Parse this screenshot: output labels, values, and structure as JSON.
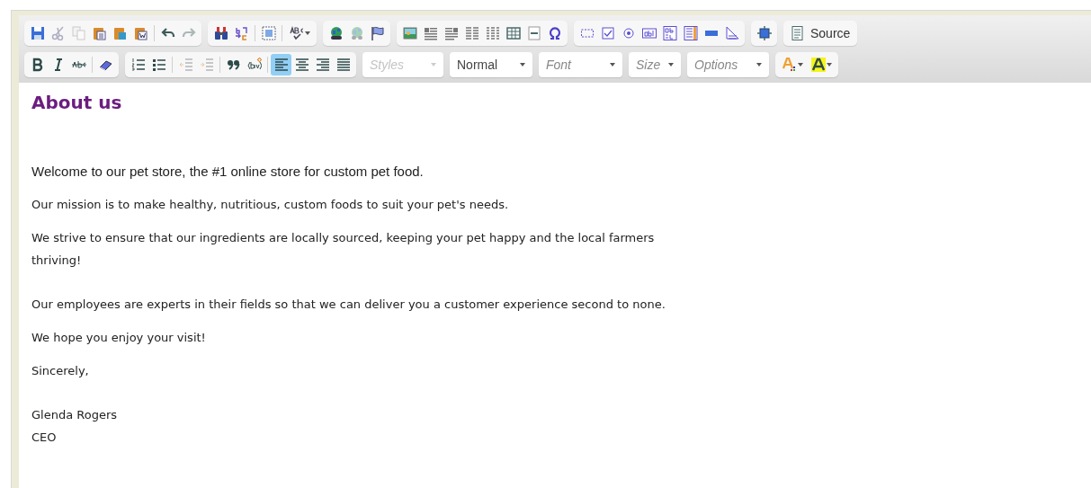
{
  "toolbar": {
    "rows": [
      [
        {
          "buttons": [
            {
              "kind": "icon",
              "disabled": false
            },
            {
              "kind": "icon",
              "disabled": true
            },
            {
              "kind": "icon",
              "disabled": true
            },
            {
              "kind": "icon",
              "disabled": false
            },
            {
              "kind": "icon",
              "disabled": false
            },
            {
              "kind": "icon",
              "disabled": false
            },
            {
              "kind": "sep"
            },
            {
              "kind": "icon",
              "disabled": false
            },
            {
              "kind": "icon",
              "disabled": true
            }
          ]
        },
        {
          "buttons": [
            {
              "kind": "icon",
              "disabled": false
            },
            {
              "kind": "icon",
              "disabled": false
            },
            {
              "kind": "sep"
            },
            {
              "kind": "icon",
              "disabled": false
            },
            {
              "kind": "sep"
            },
            {
              "kind": "menu",
              "disabled": false
            }
          ]
        },
        {
          "buttons": [
            {
              "kind": "icon",
              "disabled": false
            },
            {
              "kind": "icon",
              "disabled": true
            },
            {
              "kind": "icon",
              "disabled": false
            }
          ]
        },
        {
          "buttons": [
            {
              "kind": "icon",
              "disabled": false
            },
            {
              "kind": "icon",
              "disabled": false
            },
            {
              "kind": "icon",
              "disabled": false
            },
            {
              "kind": "icon",
              "disabled": false
            },
            {
              "kind": "icon",
              "disabled": false
            },
            {
              "kind": "icon",
              "disabled": false
            },
            {
              "kind": "icon",
              "disabled": false
            },
            {
              "kind": "icon",
              "disabled": false
            }
          ]
        },
        {
          "buttons": [
            {
              "kind": "icon",
              "disabled": false
            },
            {
              "kind": "icon",
              "disabled": false
            },
            {
              "kind": "icon",
              "disabled": false
            },
            {
              "kind": "icon",
              "disabled": false
            },
            {
              "kind": "icon",
              "disabled": false
            },
            {
              "kind": "icon",
              "disabled": false
            },
            {
              "kind": "icon",
              "disabled": false
            },
            {
              "kind": "icon",
              "disabled": false
            }
          ]
        },
        {
          "buttons": [
            {
              "kind": "icon",
              "disabled": false
            }
          ]
        },
        {
          "buttons": [
            {
              "kind": "text",
              "label": "Source"
            }
          ]
        }
      ],
      [
        {
          "buttons": [
            {
              "kind": "icon",
              "disabled": false,
              "selected": false
            },
            {
              "kind": "icon",
              "disabled": false,
              "selected": false
            },
            {
              "kind": "icon",
              "disabled": false,
              "selected": false
            },
            {
              "kind": "sep"
            },
            {
              "kind": "icon",
              "disabled": false,
              "selected": false
            }
          ]
        },
        {
          "buttons": [
            {
              "kind": "icon",
              "disabled": false,
              "selected": false
            },
            {
              "kind": "icon",
              "disabled": false,
              "selected": false
            },
            {
              "kind": "sep"
            },
            {
              "kind": "icon",
              "disabled": true,
              "selected": false
            },
            {
              "kind": "icon",
              "disabled": true,
              "selected": false
            },
            {
              "kind": "sep"
            },
            {
              "kind": "icon",
              "disabled": false,
              "selected": false
            },
            {
              "kind": "icon",
              "disabled": false,
              "selected": false
            },
            {
              "kind": "sep"
            },
            {
              "kind": "icon",
              "disabled": false,
              "selected": true
            },
            {
              "kind": "icon",
              "disabled": false,
              "selected": false
            },
            {
              "kind": "icon",
              "disabled": false,
              "selected": false
            },
            {
              "kind": "icon",
              "disabled": false,
              "selected": false
            }
          ]
        },
        {
          "buttons": [
            {
              "kind": "combo",
              "placeholder": "Styles",
              "disabled": true
            }
          ]
        },
        {
          "buttons": [
            {
              "kind": "combo",
              "value": "Normal",
              "disabled": false
            }
          ]
        },
        {
          "buttons": [
            {
              "kind": "combo",
              "placeholder": "Font",
              "disabled": false
            }
          ]
        },
        {
          "buttons": [
            {
              "kind": "combo",
              "placeholder": "Size",
              "disabled": false
            }
          ]
        },
        {
          "buttons": [
            {
              "kind": "combo",
              "placeholder": "Options",
              "disabled": false
            }
          ]
        },
        {
          "buttons": [
            {
              "kind": "menu",
              "disabled": false
            },
            {
              "kind": "menu",
              "disabled": false
            }
          ]
        }
      ]
    ]
  },
  "content": [
    {
      "kind": "heading",
      "text": "About us"
    },
    {
      "kind": "lead",
      "text": "Welcome to our pet store, the #1 online store for custom pet food."
    },
    {
      "kind": "paragraph",
      "text": "Our mission is to make healthy, nutritious, custom foods to suit your pet's needs."
    },
    {
      "kind": "paragraph",
      "text": "We strive to ensure that our ingredients are locally sourced, keeping your pet happy and the local farmers thriving!"
    },
    {
      "kind": "paragraph",
      "text": "Our employees are experts in their fields so that we can deliver you a customer experience second to none."
    },
    {
      "kind": "paragraph",
      "text": "We hope you enjoy your visit!"
    },
    {
      "kind": "paragraph",
      "text": "Sincerely,"
    },
    {
      "kind": "paragraph",
      "text": "Glenda Rogers"
    },
    {
      "kind": "paragraph",
      "text": "CEO"
    }
  ]
}
